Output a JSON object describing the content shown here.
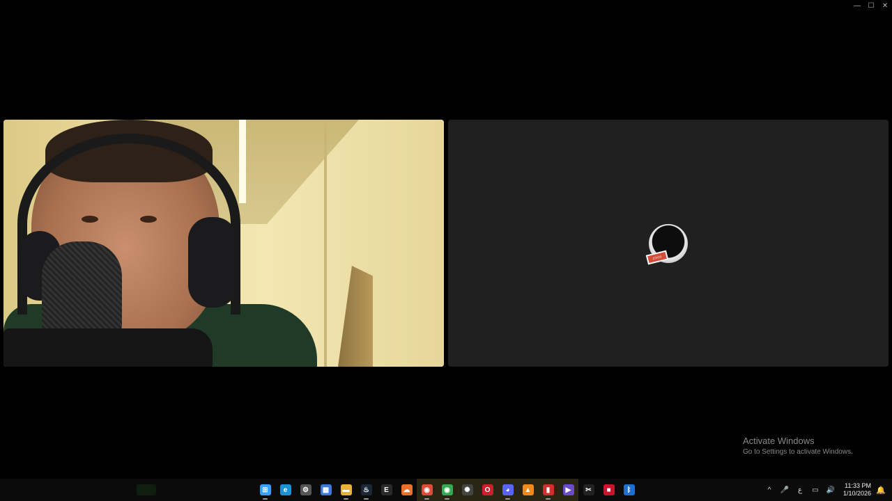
{
  "window": {
    "controls": {
      "minimize": "—",
      "maximize": "☐",
      "close": "✕"
    }
  },
  "watermark": {
    "title": "Activate Windows",
    "subtitle": "Go to Settings to activate Windows."
  },
  "taskbar": {
    "apps": [
      {
        "name": "windows-start-icon",
        "glyph": "⊞",
        "color": "#3aa0ff"
      },
      {
        "name": "edge-icon",
        "glyph": "e",
        "color": "#1e90d6"
      },
      {
        "name": "settings-gear-icon",
        "glyph": "⚙",
        "color": "#555555"
      },
      {
        "name": "microsoft-store-icon",
        "glyph": "▦",
        "color": "#3c78d8"
      },
      {
        "name": "file-explorer-icon",
        "glyph": "▬",
        "color": "#e8b13a"
      },
      {
        "name": "steam-icon",
        "glyph": "♨",
        "color": "#1b2838"
      },
      {
        "name": "epic-games-icon",
        "glyph": "E",
        "color": "#2a2a2a"
      },
      {
        "name": "cloud-app-icon",
        "glyph": "☁",
        "color": "#e8702a"
      },
      {
        "name": "chrome-icon",
        "glyph": "◉",
        "color": "#dd4b39"
      },
      {
        "name": "chrome-profile-icon",
        "glyph": "◉",
        "color": "#34a853"
      },
      {
        "name": "chatgpt-icon",
        "glyph": "✺",
        "color": "#444444"
      },
      {
        "name": "opera-icon",
        "glyph": "O",
        "color": "#cc1f2e"
      },
      {
        "name": "discord-icon",
        "glyph": "◕",
        "color": "#5865f2"
      },
      {
        "name": "vlc-icon",
        "glyph": "▲",
        "color": "#f08a1c"
      },
      {
        "name": "flstudio-icon",
        "glyph": "▮",
        "color": "#d12d2d"
      },
      {
        "name": "media-player-icon",
        "glyph": "▶",
        "color": "#6a4cc9"
      },
      {
        "name": "capcut-icon",
        "glyph": "✂",
        "color": "#222222"
      },
      {
        "name": "recorder-icon",
        "glyph": "■",
        "color": "#c7162b"
      },
      {
        "name": "bluetooth-app-icon",
        "glyph": "ᛒ",
        "color": "#1f6fd1"
      }
    ],
    "tray": {
      "chevron": "^",
      "mic": "🎤",
      "language": "ع",
      "network": "▭",
      "volume": "🔊",
      "time": "11:33 PM",
      "date": "1/10/2026",
      "notification": "🔔"
    }
  },
  "avatar_badge": "▭▭"
}
